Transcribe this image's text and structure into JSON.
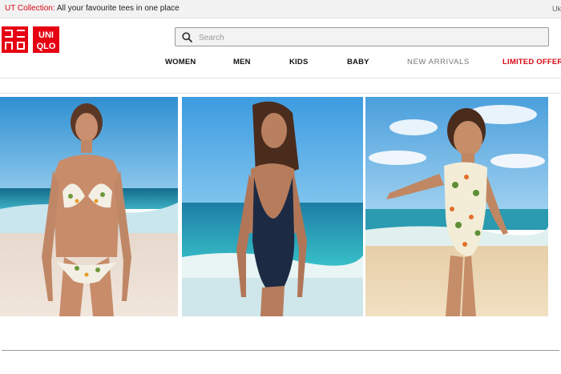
{
  "promo": {
    "lead": "UT Collection:",
    "text": " All your favourite tees in one place",
    "lang": "Uk"
  },
  "brand": {
    "name": "UNIQLO",
    "top_glyphs": "ユニクロ",
    "bottom_text": "UNIQLO",
    "color": "#e60012"
  },
  "search": {
    "placeholder": "Search",
    "value": "",
    "icon": "search-icon"
  },
  "nav": {
    "items": [
      {
        "label": "WOMEN"
      },
      {
        "label": "MEN"
      },
      {
        "label": "KIDS"
      },
      {
        "label": "BABY"
      },
      {
        "label": "NEW ARRIVALS"
      },
      {
        "label": "LIMITED OFFERS"
      }
    ]
  },
  "colors": {
    "accent": "#d60a15",
    "sky": "#3ea3dc",
    "sea": "#1c9fb7",
    "sand": "#e9dccd"
  },
  "hero": {
    "images": [
      {
        "description": "woman-in-floral-bikini-on-beach"
      },
      {
        "description": "woman-in-navy-swimsuit-by-sea"
      },
      {
        "description": "girl-in-floral-swimsuit-on-beach"
      }
    ]
  }
}
